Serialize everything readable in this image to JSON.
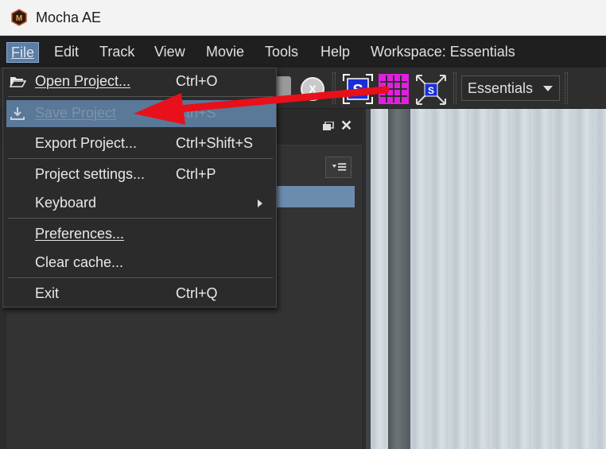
{
  "window": {
    "title": "Mocha AE",
    "app_icon_letter": "M"
  },
  "menubar": {
    "items": [
      {
        "label": "File",
        "active": true
      },
      {
        "label": "Edit"
      },
      {
        "label": "Track"
      },
      {
        "label": "View"
      },
      {
        "label": "Movie"
      },
      {
        "label": "Tools"
      },
      {
        "label": "Help"
      },
      {
        "label": "Workspace: Essentials"
      }
    ]
  },
  "toolbar": {
    "s_button_letter": "S",
    "track_button_letter": "S",
    "x_button_letter": "X",
    "workspace_select": {
      "value": "Essentials"
    }
  },
  "file_menu": {
    "items": [
      {
        "label": "Open Project...",
        "shortcut": "Ctrl+O",
        "icon": "folder-icon"
      },
      {
        "label": "Save Project",
        "shortcut": "Ctrl+S",
        "icon": "download-icon",
        "highlighted": true,
        "disabled": true
      },
      {
        "label": "Export Project...",
        "shortcut": "Ctrl+Shift+S"
      },
      {
        "label": "Project settings...",
        "shortcut": "Ctrl+P"
      },
      {
        "label": "Keyboard",
        "shortcut": "",
        "submenu": true
      },
      {
        "label": "Preferences...",
        "shortcut": ""
      },
      {
        "label": "Clear cache...",
        "shortcut": ""
      },
      {
        "label": "Exit",
        "shortcut": "Ctrl+Q"
      }
    ]
  },
  "colors": {
    "accent": "#5b7da6",
    "menu_bg": "#2b2b2b",
    "annotation_arrow": "#e8101a",
    "grid_button": "#e020e0",
    "s_button": "#1a2ed8"
  }
}
